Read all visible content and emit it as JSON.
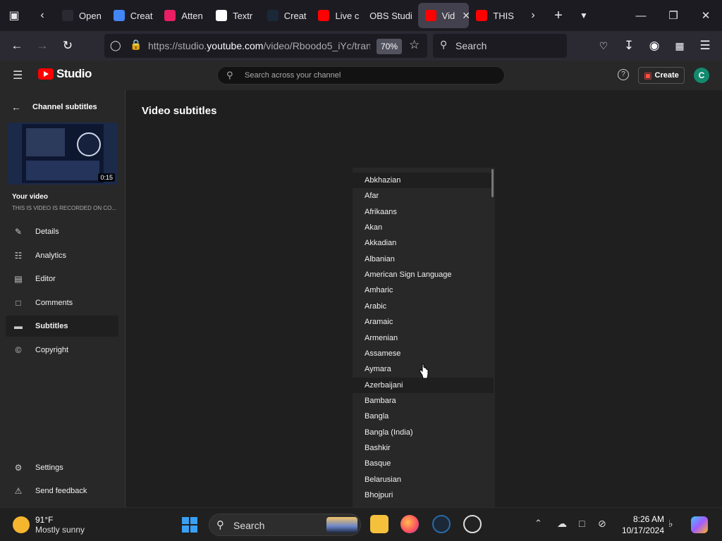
{
  "browser": {
    "tabs": [
      {
        "label": "Open",
        "color": "#2b2a33"
      },
      {
        "label": "Creat",
        "color": "#4285f4"
      },
      {
        "label": "Atten",
        "color": "#e91e63"
      },
      {
        "label": "Textr",
        "color": "#ffffff"
      },
      {
        "label": "Creat",
        "color": "#1b2838"
      },
      {
        "label": "Live c",
        "color": "#ff0000"
      },
      {
        "label": "OBS Studi",
        "color": "#1c1b22"
      },
      {
        "label": "Vid",
        "color": "#ff0000"
      },
      {
        "label": "THIS",
        "color": "#ff0000"
      }
    ],
    "active_tab_index": 7,
    "url_prefix": "https://studio.",
    "url_domain": "youtube.com",
    "url_rest": "/video/Rboodo5_iYc/tran",
    "zoom": "70%",
    "search_placeholder": "Search"
  },
  "studio": {
    "logo_text": "Studio",
    "search_placeholder": "Search across your channel",
    "create_label": "Create",
    "avatar_letter": "C"
  },
  "sidebar": {
    "back_label": "Channel subtitles",
    "duration": "0:15",
    "your_video": "Your video",
    "video_title": "THIS IS VIDEO IS RECORDED ON CO...",
    "items": [
      {
        "label": "Details",
        "icon": "pencil-icon"
      },
      {
        "label": "Analytics",
        "icon": "analytics-icon"
      },
      {
        "label": "Editor",
        "icon": "film-icon"
      },
      {
        "label": "Comments",
        "icon": "comment-icon"
      },
      {
        "label": "Subtitles",
        "icon": "subtitles-icon"
      },
      {
        "label": "Copyright",
        "icon": "copyright-icon"
      }
    ],
    "active_index": 4,
    "settings_label": "Settings",
    "feedback_label": "Send feedback"
  },
  "main": {
    "title": "Video subtitles",
    "languages": [
      "Abkhazian",
      "Afar",
      "Afrikaans",
      "Akan",
      "Akkadian",
      "Albanian",
      "American Sign Language",
      "Amharic",
      "Arabic",
      "Aramaic",
      "Armenian",
      "Assamese",
      "Aymara",
      "Azerbaijani",
      "Bambara",
      "Bangla",
      "Bangla (India)",
      "Bashkir",
      "Basque",
      "Belarusian",
      "Bhojpuri"
    ],
    "highlighted": [
      0,
      13
    ]
  },
  "taskbar": {
    "temp": "91°F",
    "weather": "Mostly sunny",
    "search_placeholder": "Search",
    "time": "8:26 AM",
    "date": "10/17/2024"
  }
}
